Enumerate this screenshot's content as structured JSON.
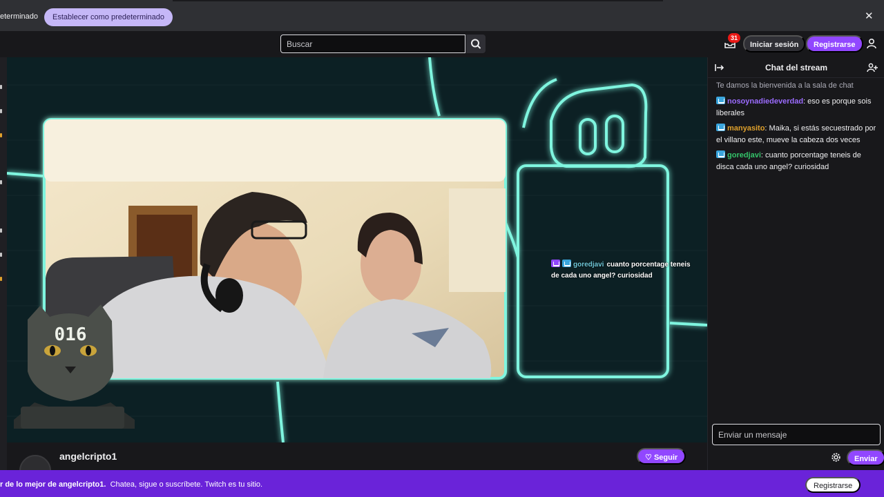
{
  "banner": {
    "text": "eterminado",
    "default_button": "Establecer como predeterminado",
    "close": "✕"
  },
  "topnav": {
    "search_placeholder": "Buscar",
    "notifications_count": "31",
    "login_label": "Iniciar sesión",
    "register_label": "Registrarse"
  },
  "stream": {
    "overlay_number": "016",
    "overlay_username": "goredjavi",
    "overlay_message": "cuanto porcentage teneis de cada uno angel? curiosidad"
  },
  "channel": {
    "name": "angelcripto1",
    "follow_label": "Seguir"
  },
  "chat": {
    "title": "Chat del stream",
    "welcome": "Te damos la bienvenida a la sala de chat",
    "messages": [
      {
        "user": "nosoynadiedeverdad",
        "color": "#9b6bff",
        "text": ": eso es porque sois liberales"
      },
      {
        "user": "manyasito",
        "color": "#e0a12c",
        "text": ": Maika, si estás secuestrado por el villano este, mueve la cabeza dos veces"
      },
      {
        "user": "goredjavi",
        "color": "#34c46a",
        "text": ": cuanto porcentage teneis de disca cada uno angel? curiosidad"
      }
    ],
    "input_placeholder": "Enviar un mensaje",
    "send_label": "Enviar"
  },
  "bottom_bar": {
    "prefix": "r de lo mejor de angelcripto1.",
    "suffix": "Chatea, sigue o suscríbete. Twitch es tu sitio.",
    "register_label": "Registrarse"
  },
  "colors": {
    "accent": "#9147ff",
    "neon": "#7ff5df",
    "bottom_bar": "#6a23d9"
  }
}
